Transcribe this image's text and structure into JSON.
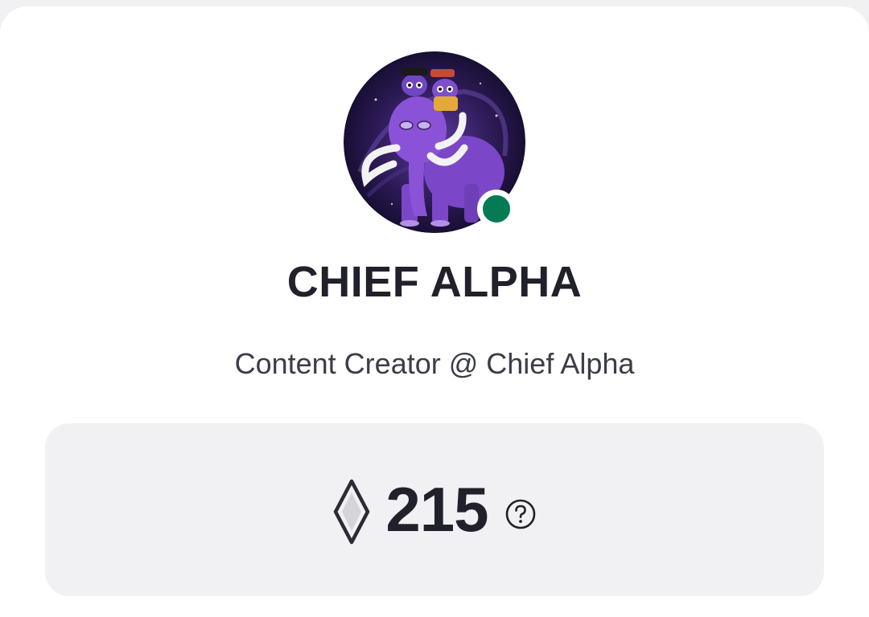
{
  "profile": {
    "name": "CHIEF ALPHA",
    "subtitle": "Content Creator @ Chief Alpha",
    "status": "online",
    "status_color": "#067a55",
    "avatar_icon": "mammoth-avatar"
  },
  "points": {
    "value": "215",
    "icon": "diamond-gem-icon",
    "help_icon": "question-circle-icon"
  },
  "colors": {
    "card_bg": "#ffffff",
    "page_bg": "#f1f1f3",
    "text_primary": "#20212a",
    "text_secondary": "#3b3d47"
  }
}
